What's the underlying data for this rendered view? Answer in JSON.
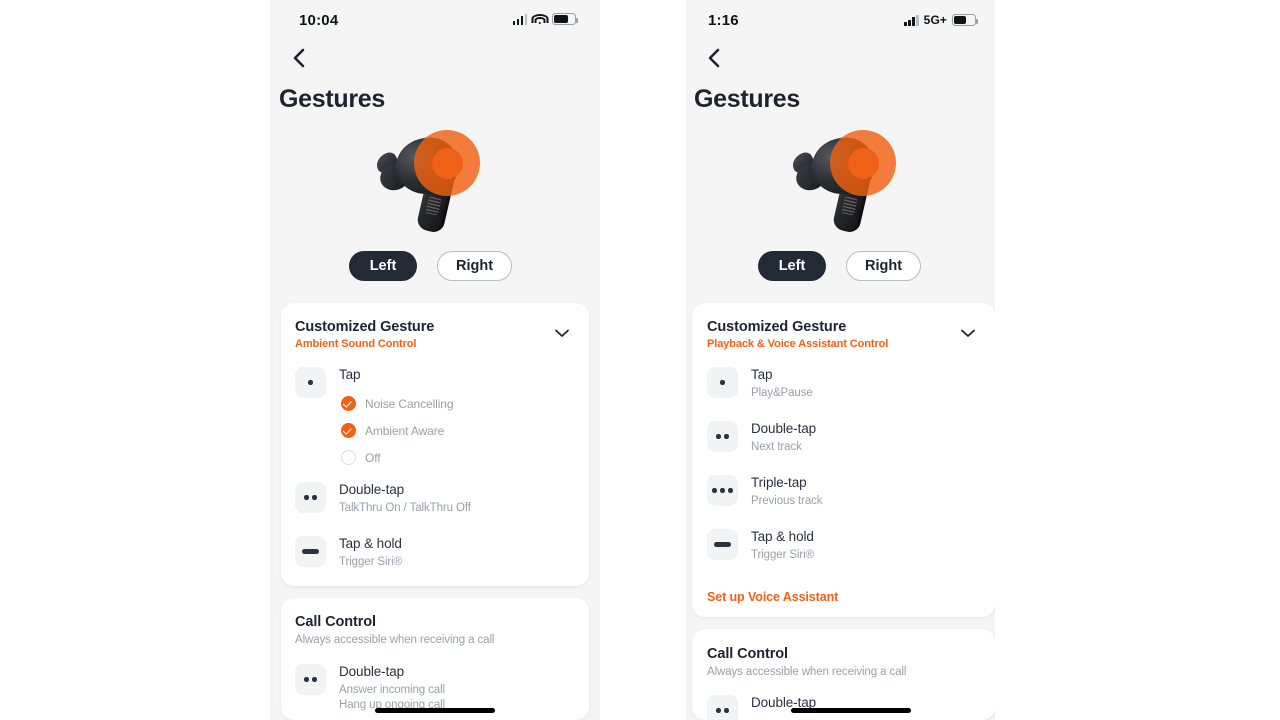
{
  "panels": [
    {
      "id": "left",
      "status": {
        "time": "10:04",
        "network_icon": "wifi-icon",
        "network_label": "",
        "signal_icon": "cellular-signal-icon",
        "battery_icon": "battery-icon"
      },
      "nav": {
        "back_icon": "chevron-left-icon",
        "title": "Gestures"
      },
      "hero": {
        "image": "earbud-illustration",
        "touch_area_icon": "touch-area-highlight"
      },
      "toggle": {
        "left_label": "Left",
        "right_label": "Right",
        "selected": "Left"
      },
      "cards": [
        {
          "title": "Customized Gesture",
          "subtitle": "Ambient Sound Control",
          "subtitle_color": "#ef6116",
          "chevron_icon": "chevron-down-icon",
          "rows": [
            {
              "icon": "single-tap-icon",
              "name": "Tap",
              "desc": "",
              "options": [
                {
                  "label": "Noise Cancelling",
                  "checked": true
                },
                {
                  "label": "Ambient Aware",
                  "checked": true
                },
                {
                  "label": "Off",
                  "checked": false
                }
              ]
            },
            {
              "icon": "double-tap-icon",
              "name": "Double-tap",
              "desc": "TalkThru On / TalkThru Off"
            },
            {
              "icon": "tap-hold-icon",
              "name": "Tap & hold",
              "desc": "Trigger Siri®"
            }
          ]
        },
        {
          "title": "Call Control",
          "subtitle": "Always accessible when receiving a call",
          "subtitle_color": "#9aa0aa",
          "rows": [
            {
              "icon": "double-tap-icon",
              "name": "Double-tap",
              "desc": "Answer incoming call",
              "desc2": "Hang up ongoing call"
            }
          ]
        }
      ]
    },
    {
      "id": "right",
      "status": {
        "time": "1:16",
        "network_icon": "cellular-5g-icon",
        "network_label": "5G+",
        "signal_icon": "cellular-signal-icon",
        "battery_icon": "battery-icon"
      },
      "nav": {
        "back_icon": "chevron-left-icon",
        "title": "Gestures"
      },
      "hero": {
        "image": "earbud-illustration",
        "touch_area_icon": "touch-area-highlight"
      },
      "toggle": {
        "left_label": "Left",
        "right_label": "Right",
        "selected": "Left"
      },
      "cards": [
        {
          "title": "Customized Gesture",
          "subtitle": "Playback & Voice Assistant Control",
          "subtitle_color": "#ef6116",
          "chevron_icon": "chevron-down-icon",
          "link": "Set up Voice Assistant",
          "rows": [
            {
              "icon": "single-tap-icon",
              "name": "Tap",
              "desc": "Play&Pause"
            },
            {
              "icon": "double-tap-icon",
              "name": "Double-tap",
              "desc": "Next track"
            },
            {
              "icon": "triple-tap-icon",
              "name": "Triple-tap",
              "desc": "Previous track"
            },
            {
              "icon": "tap-hold-icon",
              "name": "Tap & hold",
              "desc": "Trigger Siri®"
            }
          ]
        },
        {
          "title": "Call Control",
          "subtitle": "Always accessible when receiving a call",
          "subtitle_color": "#9aa0aa",
          "rows": [
            {
              "icon": "double-tap-icon",
              "name": "Double-tap",
              "desc": ""
            }
          ]
        }
      ]
    }
  ],
  "colors": {
    "accent": "#ef6116",
    "dark": "#222a36",
    "page_bg": "#f5f5f5",
    "card_bg": "#ffffff",
    "muted": "#9aa0aa"
  }
}
